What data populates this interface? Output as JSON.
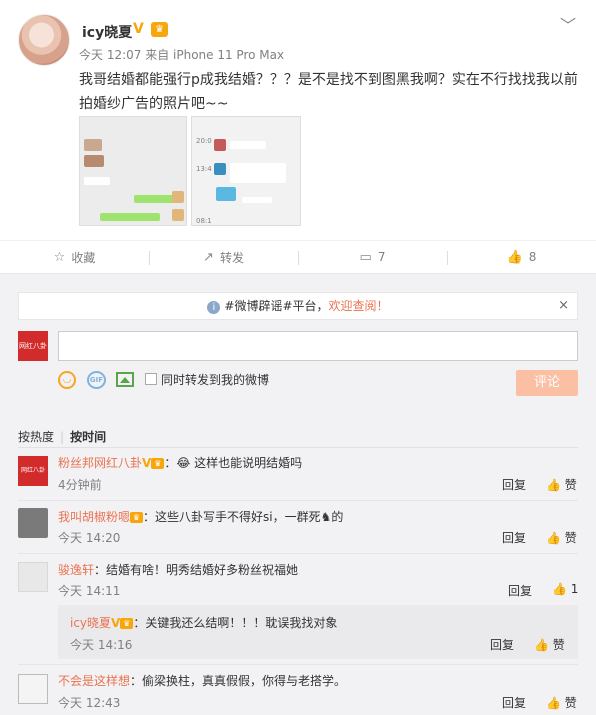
{
  "post": {
    "username": "icy晓夏",
    "badge_v": "V",
    "badge_vip": "♛",
    "meta": "今天 12:07 来自 iPhone 11 Pro Max",
    "text": "我哥结婚都能强行p成我结婚？？？是不是找不到图黑我啊？实在不行找找我以前拍婚纱广告的照片吧~~",
    "thumb2_labels": [
      "20:0",
      "13:4",
      "08:1"
    ]
  },
  "actions": {
    "favorite": "收藏",
    "repost": "转发",
    "comment_count": "7",
    "like_count": "8"
  },
  "notice": {
    "prefix": "#微博辟谣#平台，",
    "link": "欢迎查阅！",
    "close": "×"
  },
  "composer": {
    "avatar_text": "网红八卦",
    "checkbox_label": "同时转发到我的微博",
    "submit_label": "评论"
  },
  "sort": {
    "by_hot": "按热度",
    "separator": "|",
    "by_time": "按时间"
  },
  "comments": [
    {
      "name": "粉丝邦网红八卦",
      "text": "：😂 这样也能说明结婚吗",
      "time": "4分钟前",
      "reply": "回复",
      "like": "赞"
    },
    {
      "name": "我叫胡椒粉嗯",
      "text": "：这些八卦写手不得好si，一群死♞的",
      "time": "今天 14:20",
      "reply": "回复",
      "like": "赞"
    },
    {
      "name": "骏逸轩",
      "text": "：结婚有啥！明秀结婚好多粉丝祝福她",
      "time": "今天 14:11",
      "reply": "回复",
      "like": "1"
    },
    {
      "name": "icy晓夏",
      "text": "：关键我还么结啊！！！耽误我找对象",
      "time": "今天 14:16",
      "reply": "回复",
      "like": "赞"
    },
    {
      "name": "不会是这样想",
      "text": "：偷梁换柱，真真假假，你得与老搭学。",
      "time": "今天 12:43",
      "reply": "回复",
      "like": "赞"
    }
  ]
}
